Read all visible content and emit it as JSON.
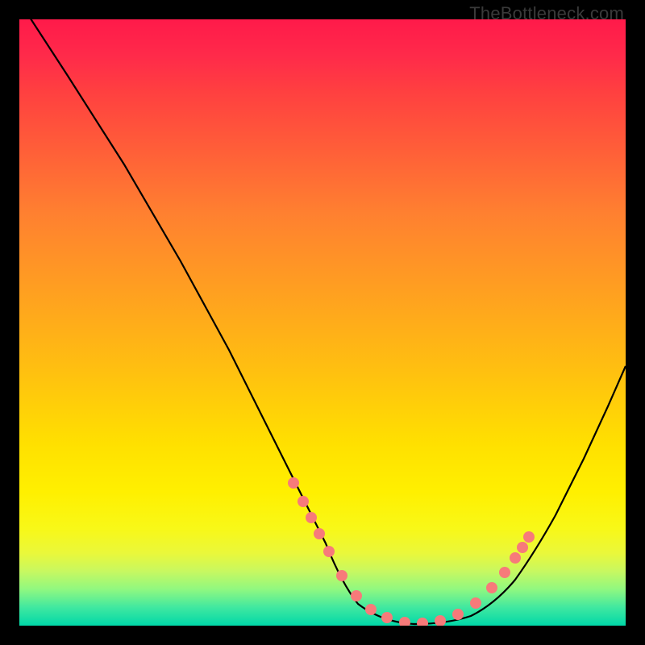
{
  "watermark": "TheBottleneck.com",
  "chart_data": {
    "type": "line",
    "title": "",
    "xlabel": "",
    "ylabel": "",
    "xlim": [
      0,
      100
    ],
    "ylim": [
      0,
      100
    ],
    "series": [
      {
        "name": "bottleneck-curve",
        "x": [
          0,
          5,
          10,
          15,
          20,
          25,
          30,
          35,
          40,
          45,
          48,
          50,
          53,
          56,
          60,
          63,
          66,
          70,
          74,
          78,
          82,
          86,
          90,
          95,
          100
        ],
        "y": [
          100,
          92,
          83,
          74,
          65,
          56,
          47,
          38,
          29,
          20,
          14,
          10,
          6,
          3,
          1,
          0,
          0,
          1,
          3,
          7,
          12,
          18,
          25,
          34,
          44
        ]
      }
    ],
    "markers": {
      "name": "sample-dots",
      "x": [
        42,
        44,
        46,
        47,
        49,
        52,
        55,
        58,
        61,
        64,
        67,
        70,
        73,
        76,
        78,
        80,
        82
      ],
      "y": [
        24,
        20,
        16,
        13,
        9,
        5.5,
        3,
        1.5,
        0.8,
        0.5,
        0.6,
        1.2,
        2.5,
        5,
        8,
        11,
        14
      ]
    },
    "gradient_stops": [
      {
        "pos": 0,
        "color": "#ff1a4a"
      },
      {
        "pos": 12,
        "color": "#ff4040"
      },
      {
        "pos": 32,
        "color": "#ff8030"
      },
      {
        "pos": 58,
        "color": "#ffc010"
      },
      {
        "pos": 78,
        "color": "#fff000"
      },
      {
        "pos": 94,
        "color": "#90f880"
      },
      {
        "pos": 100,
        "color": "#00d8a8"
      }
    ]
  }
}
